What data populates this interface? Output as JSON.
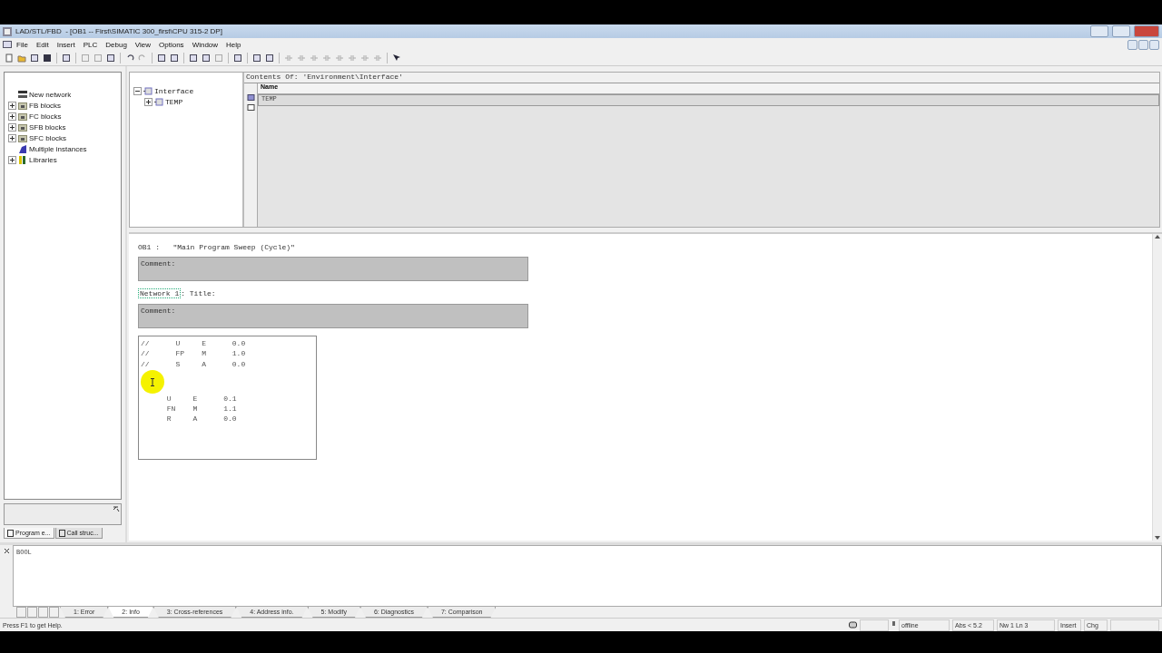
{
  "window": {
    "title": "LAD/STL/FBD  - [OB1 -- First\\SIMATIC 300_first\\CPU 315-2 DP]"
  },
  "menu": [
    "File",
    "Edit",
    "Insert",
    "PLC",
    "Debug",
    "View",
    "Options",
    "Window",
    "Help"
  ],
  "overview": {
    "items": [
      {
        "label": "New network",
        "kind": "network",
        "expandable": false
      },
      {
        "label": "FB blocks",
        "kind": "folder",
        "expandable": true
      },
      {
        "label": "FC blocks",
        "kind": "folder",
        "expandable": true
      },
      {
        "label": "SFB blocks",
        "kind": "folder",
        "expandable": true
      },
      {
        "label": "SFC blocks",
        "kind": "folder",
        "expandable": true
      },
      {
        "label": "Multiple instances",
        "kind": "instances",
        "expandable": false
      },
      {
        "label": "Libraries",
        "kind": "library",
        "expandable": true
      }
    ],
    "tabs": [
      {
        "label": "Program e...",
        "selected": true
      },
      {
        "label": "Call struc...",
        "selected": false
      }
    ]
  },
  "interface": {
    "tree": [
      {
        "label": "Interface",
        "expanded": true,
        "children": [
          {
            "label": "TEMP",
            "expanded": false
          }
        ]
      }
    ],
    "contents_title": "Contents Of: 'Environment\\Interface'",
    "columns": [
      "Name"
    ],
    "rows": [
      {
        "name": "TEMP",
        "selected": true
      }
    ]
  },
  "editor": {
    "block_title": "OB1 :   \"Main Program Sweep (Cycle)\"",
    "block_comment": "Comment:",
    "networks": [
      {
        "label": "Network 1",
        "title": ": Title:",
        "comment": "Comment:",
        "code_blocks": [
          {
            "lines": [
              "//      U     E      0.0",
              "//      FP    M      1.0",
              "//      S     A      0.0"
            ]
          },
          {
            "lines": [
              "      U     E      0.1",
              "      FN    M      1.1",
              "      R     A      0.0"
            ]
          }
        ]
      }
    ]
  },
  "details": {
    "text": "BOOL",
    "tabs": [
      {
        "label": "1: Error",
        "selected": false
      },
      {
        "label": "2: Info",
        "selected": true
      },
      {
        "label": "3: Cross-references",
        "selected": false
      },
      {
        "label": "4: Address info.",
        "selected": false
      },
      {
        "label": "5: Modify",
        "selected": false
      },
      {
        "label": "6: Diagnostics",
        "selected": false
      },
      {
        "label": "7: Comparison",
        "selected": false
      }
    ]
  },
  "status_bar": {
    "help": "Press F1 to get Help.",
    "mode": "offline",
    "abs": "Abs < 5.2",
    "position": "Nw 1  Ln 3",
    "insert": "Insert",
    "changed": "Chg"
  }
}
